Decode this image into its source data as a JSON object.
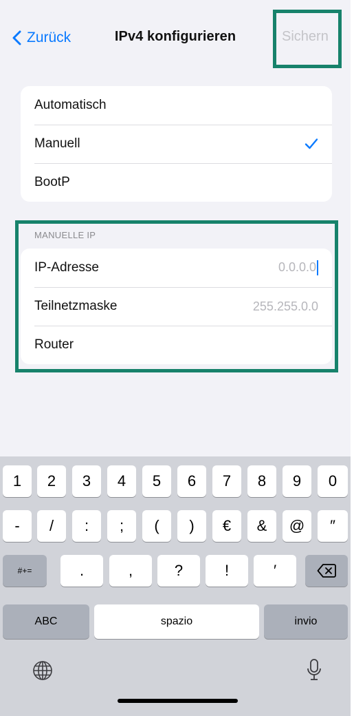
{
  "nav": {
    "back_label": "Zurück",
    "title": "IPv4 konfigurieren",
    "save_label": "Sichern"
  },
  "mode_options": [
    {
      "label": "Automatisch",
      "selected": false
    },
    {
      "label": "Manuell",
      "selected": true
    },
    {
      "label": "BootP",
      "selected": false
    }
  ],
  "manual_ip": {
    "header": "MANUELLE IP",
    "fields": [
      {
        "label": "IP-Adresse",
        "placeholder": "0.0.0.0",
        "focused": true
      },
      {
        "label": "Teilnetzmaske",
        "placeholder": "255.255.0.0",
        "focused": false
      },
      {
        "label": "Router",
        "placeholder": "",
        "focused": false
      }
    ]
  },
  "keyboard": {
    "row1": [
      "1",
      "2",
      "3",
      "4",
      "5",
      "6",
      "7",
      "8",
      "9",
      "0"
    ],
    "row2": [
      "-",
      "/",
      ":",
      ";",
      "(",
      ")",
      "€",
      "&",
      "@",
      "″"
    ],
    "row3": [
      ".",
      ",",
      "?",
      "!",
      "′"
    ],
    "symbols_label": "#+=",
    "abc_label": "ABC",
    "space_label": "spazio",
    "return_label": "invio"
  },
  "colors": {
    "accent": "#0a7aff",
    "highlight_box": "#17826b",
    "placeholder": "#b6b6bb",
    "keyboard_bg": "#d1d3d9"
  },
  "icons": {
    "back": "chevron-left-icon",
    "check": "checkmark-icon",
    "delete": "backspace-icon",
    "globe": "globe-icon",
    "mic": "microphone-icon"
  }
}
